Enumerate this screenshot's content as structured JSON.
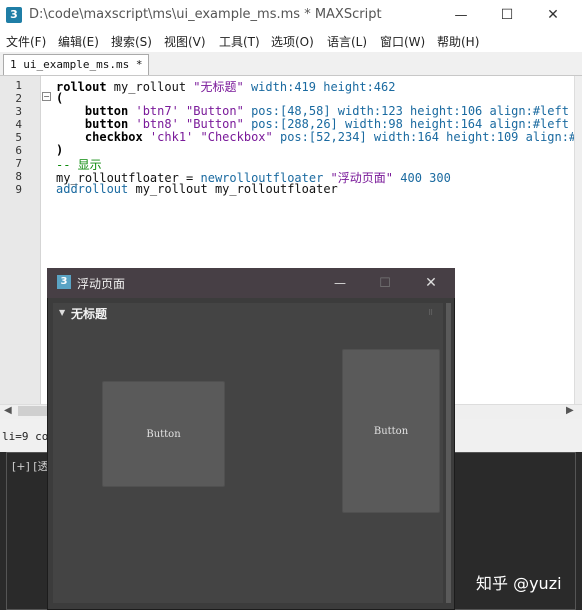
{
  "window": {
    "title": "D:\\code\\maxscript\\ms\\ui_example_ms.ms * MAXScript",
    "app_icon": "3",
    "controls": {
      "minimize": "—",
      "maximize": "☐",
      "close": "✕"
    }
  },
  "menu": [
    "文件(F)",
    "编辑(E)",
    "搜索(S)",
    "视图(V)",
    "工具(T)",
    "选项(O)",
    "语言(L)",
    "窗口(W)",
    "帮助(H)"
  ],
  "tab": {
    "label": "1 ui_example_ms.ms *"
  },
  "code": {
    "line_numbers": [
      "1",
      "2",
      "3",
      "4",
      "5",
      "6",
      "7",
      "8",
      "9"
    ],
    "lines": [
      [
        {
          "t": "rollout",
          "c": "kw"
        },
        {
          "t": " my_rollout ",
          "c": "plain"
        },
        {
          "t": "\"无标题\"",
          "c": "str"
        },
        {
          "t": " width:",
          "c": "num"
        },
        {
          "t": "419",
          "c": "num"
        },
        {
          "t": " height:",
          "c": "num"
        },
        {
          "t": "462",
          "c": "num"
        }
      ],
      [
        {
          "t": "(",
          "c": "kw"
        }
      ],
      [
        {
          "t": "    button",
          "c": "kw"
        },
        {
          "t": " 'btn7' ",
          "c": "str"
        },
        {
          "t": "\"Button\"",
          "c": "str"
        },
        {
          "t": " pos:",
          "c": "num"
        },
        {
          "t": "[48,58]",
          "c": "num"
        },
        {
          "t": " width:123 height:106 align:#left",
          "c": "num"
        }
      ],
      [
        {
          "t": "    button",
          "c": "kw"
        },
        {
          "t": " 'btn8' ",
          "c": "str"
        },
        {
          "t": "\"Button\"",
          "c": "str"
        },
        {
          "t": " pos:",
          "c": "num"
        },
        {
          "t": "[288,26]",
          "c": "num"
        },
        {
          "t": " width:98 height:164 align:#left",
          "c": "num"
        }
      ],
      [
        {
          "t": "    checkbox",
          "c": "kw"
        },
        {
          "t": " 'chk1' ",
          "c": "str"
        },
        {
          "t": "\"Checkbox\"",
          "c": "str"
        },
        {
          "t": " pos:",
          "c": "num"
        },
        {
          "t": "[52,234]",
          "c": "num"
        },
        {
          "t": " width:164 height:109 align:#",
          "c": "num"
        }
      ],
      [
        {
          "t": ")",
          "c": "kw"
        }
      ],
      [
        {
          "t": "-- 显示",
          "c": "cm"
        }
      ],
      [
        {
          "t": "my_rolloutfloater = ",
          "c": "plain"
        },
        {
          "t": "newrolloutfloater",
          "c": "fn"
        },
        {
          "t": " \"浮动页面\"",
          "c": "str"
        },
        {
          "t": " 400 300",
          "c": "num"
        }
      ],
      [
        {
          "t": "addrollout",
          "c": "fn"
        },
        {
          "t": " my_rollout my_rolloutfloater",
          "c": "plain"
        }
      ]
    ]
  },
  "status": {
    "text": "li=9 co="
  },
  "viewport": {
    "label": "[+] [透"
  },
  "floater": {
    "title": "浮动页面",
    "icon": "3",
    "controls": {
      "minimize": "—",
      "maximize": "☐",
      "close": "✕"
    },
    "rollout": {
      "title": "无标题",
      "arrow": "▼",
      "grip": "⠿",
      "buttons": [
        {
          "label": "Button"
        },
        {
          "label": "Button"
        }
      ]
    }
  },
  "watermark": "知乎 @yuzi"
}
